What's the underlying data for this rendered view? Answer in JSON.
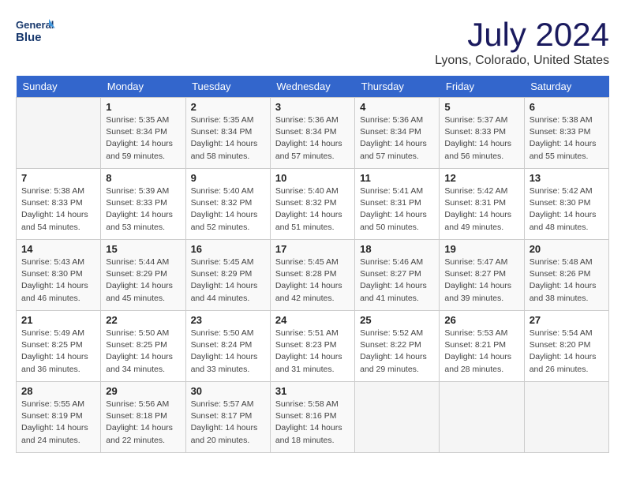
{
  "header": {
    "logo_line1": "General",
    "logo_line2": "Blue",
    "month_year": "July 2024",
    "location": "Lyons, Colorado, United States"
  },
  "weekdays": [
    "Sunday",
    "Monday",
    "Tuesday",
    "Wednesday",
    "Thursday",
    "Friday",
    "Saturday"
  ],
  "weeks": [
    [
      {
        "day": "",
        "info": ""
      },
      {
        "day": "1",
        "info": "Sunrise: 5:35 AM\nSunset: 8:34 PM\nDaylight: 14 hours\nand 59 minutes."
      },
      {
        "day": "2",
        "info": "Sunrise: 5:35 AM\nSunset: 8:34 PM\nDaylight: 14 hours\nand 58 minutes."
      },
      {
        "day": "3",
        "info": "Sunrise: 5:36 AM\nSunset: 8:34 PM\nDaylight: 14 hours\nand 57 minutes."
      },
      {
        "day": "4",
        "info": "Sunrise: 5:36 AM\nSunset: 8:34 PM\nDaylight: 14 hours\nand 57 minutes."
      },
      {
        "day": "5",
        "info": "Sunrise: 5:37 AM\nSunset: 8:33 PM\nDaylight: 14 hours\nand 56 minutes."
      },
      {
        "day": "6",
        "info": "Sunrise: 5:38 AM\nSunset: 8:33 PM\nDaylight: 14 hours\nand 55 minutes."
      }
    ],
    [
      {
        "day": "7",
        "info": "Sunrise: 5:38 AM\nSunset: 8:33 PM\nDaylight: 14 hours\nand 54 minutes."
      },
      {
        "day": "8",
        "info": "Sunrise: 5:39 AM\nSunset: 8:33 PM\nDaylight: 14 hours\nand 53 minutes."
      },
      {
        "day": "9",
        "info": "Sunrise: 5:40 AM\nSunset: 8:32 PM\nDaylight: 14 hours\nand 52 minutes."
      },
      {
        "day": "10",
        "info": "Sunrise: 5:40 AM\nSunset: 8:32 PM\nDaylight: 14 hours\nand 51 minutes."
      },
      {
        "day": "11",
        "info": "Sunrise: 5:41 AM\nSunset: 8:31 PM\nDaylight: 14 hours\nand 50 minutes."
      },
      {
        "day": "12",
        "info": "Sunrise: 5:42 AM\nSunset: 8:31 PM\nDaylight: 14 hours\nand 49 minutes."
      },
      {
        "day": "13",
        "info": "Sunrise: 5:42 AM\nSunset: 8:30 PM\nDaylight: 14 hours\nand 48 minutes."
      }
    ],
    [
      {
        "day": "14",
        "info": "Sunrise: 5:43 AM\nSunset: 8:30 PM\nDaylight: 14 hours\nand 46 minutes."
      },
      {
        "day": "15",
        "info": "Sunrise: 5:44 AM\nSunset: 8:29 PM\nDaylight: 14 hours\nand 45 minutes."
      },
      {
        "day": "16",
        "info": "Sunrise: 5:45 AM\nSunset: 8:29 PM\nDaylight: 14 hours\nand 44 minutes."
      },
      {
        "day": "17",
        "info": "Sunrise: 5:45 AM\nSunset: 8:28 PM\nDaylight: 14 hours\nand 42 minutes."
      },
      {
        "day": "18",
        "info": "Sunrise: 5:46 AM\nSunset: 8:27 PM\nDaylight: 14 hours\nand 41 minutes."
      },
      {
        "day": "19",
        "info": "Sunrise: 5:47 AM\nSunset: 8:27 PM\nDaylight: 14 hours\nand 39 minutes."
      },
      {
        "day": "20",
        "info": "Sunrise: 5:48 AM\nSunset: 8:26 PM\nDaylight: 14 hours\nand 38 minutes."
      }
    ],
    [
      {
        "day": "21",
        "info": "Sunrise: 5:49 AM\nSunset: 8:25 PM\nDaylight: 14 hours\nand 36 minutes."
      },
      {
        "day": "22",
        "info": "Sunrise: 5:50 AM\nSunset: 8:25 PM\nDaylight: 14 hours\nand 34 minutes."
      },
      {
        "day": "23",
        "info": "Sunrise: 5:50 AM\nSunset: 8:24 PM\nDaylight: 14 hours\nand 33 minutes."
      },
      {
        "day": "24",
        "info": "Sunrise: 5:51 AM\nSunset: 8:23 PM\nDaylight: 14 hours\nand 31 minutes."
      },
      {
        "day": "25",
        "info": "Sunrise: 5:52 AM\nSunset: 8:22 PM\nDaylight: 14 hours\nand 29 minutes."
      },
      {
        "day": "26",
        "info": "Sunrise: 5:53 AM\nSunset: 8:21 PM\nDaylight: 14 hours\nand 28 minutes."
      },
      {
        "day": "27",
        "info": "Sunrise: 5:54 AM\nSunset: 8:20 PM\nDaylight: 14 hours\nand 26 minutes."
      }
    ],
    [
      {
        "day": "28",
        "info": "Sunrise: 5:55 AM\nSunset: 8:19 PM\nDaylight: 14 hours\nand 24 minutes."
      },
      {
        "day": "29",
        "info": "Sunrise: 5:56 AM\nSunset: 8:18 PM\nDaylight: 14 hours\nand 22 minutes."
      },
      {
        "day": "30",
        "info": "Sunrise: 5:57 AM\nSunset: 8:17 PM\nDaylight: 14 hours\nand 20 minutes."
      },
      {
        "day": "31",
        "info": "Sunrise: 5:58 AM\nSunset: 8:16 PM\nDaylight: 14 hours\nand 18 minutes."
      },
      {
        "day": "",
        "info": ""
      },
      {
        "day": "",
        "info": ""
      },
      {
        "day": "",
        "info": ""
      }
    ]
  ]
}
